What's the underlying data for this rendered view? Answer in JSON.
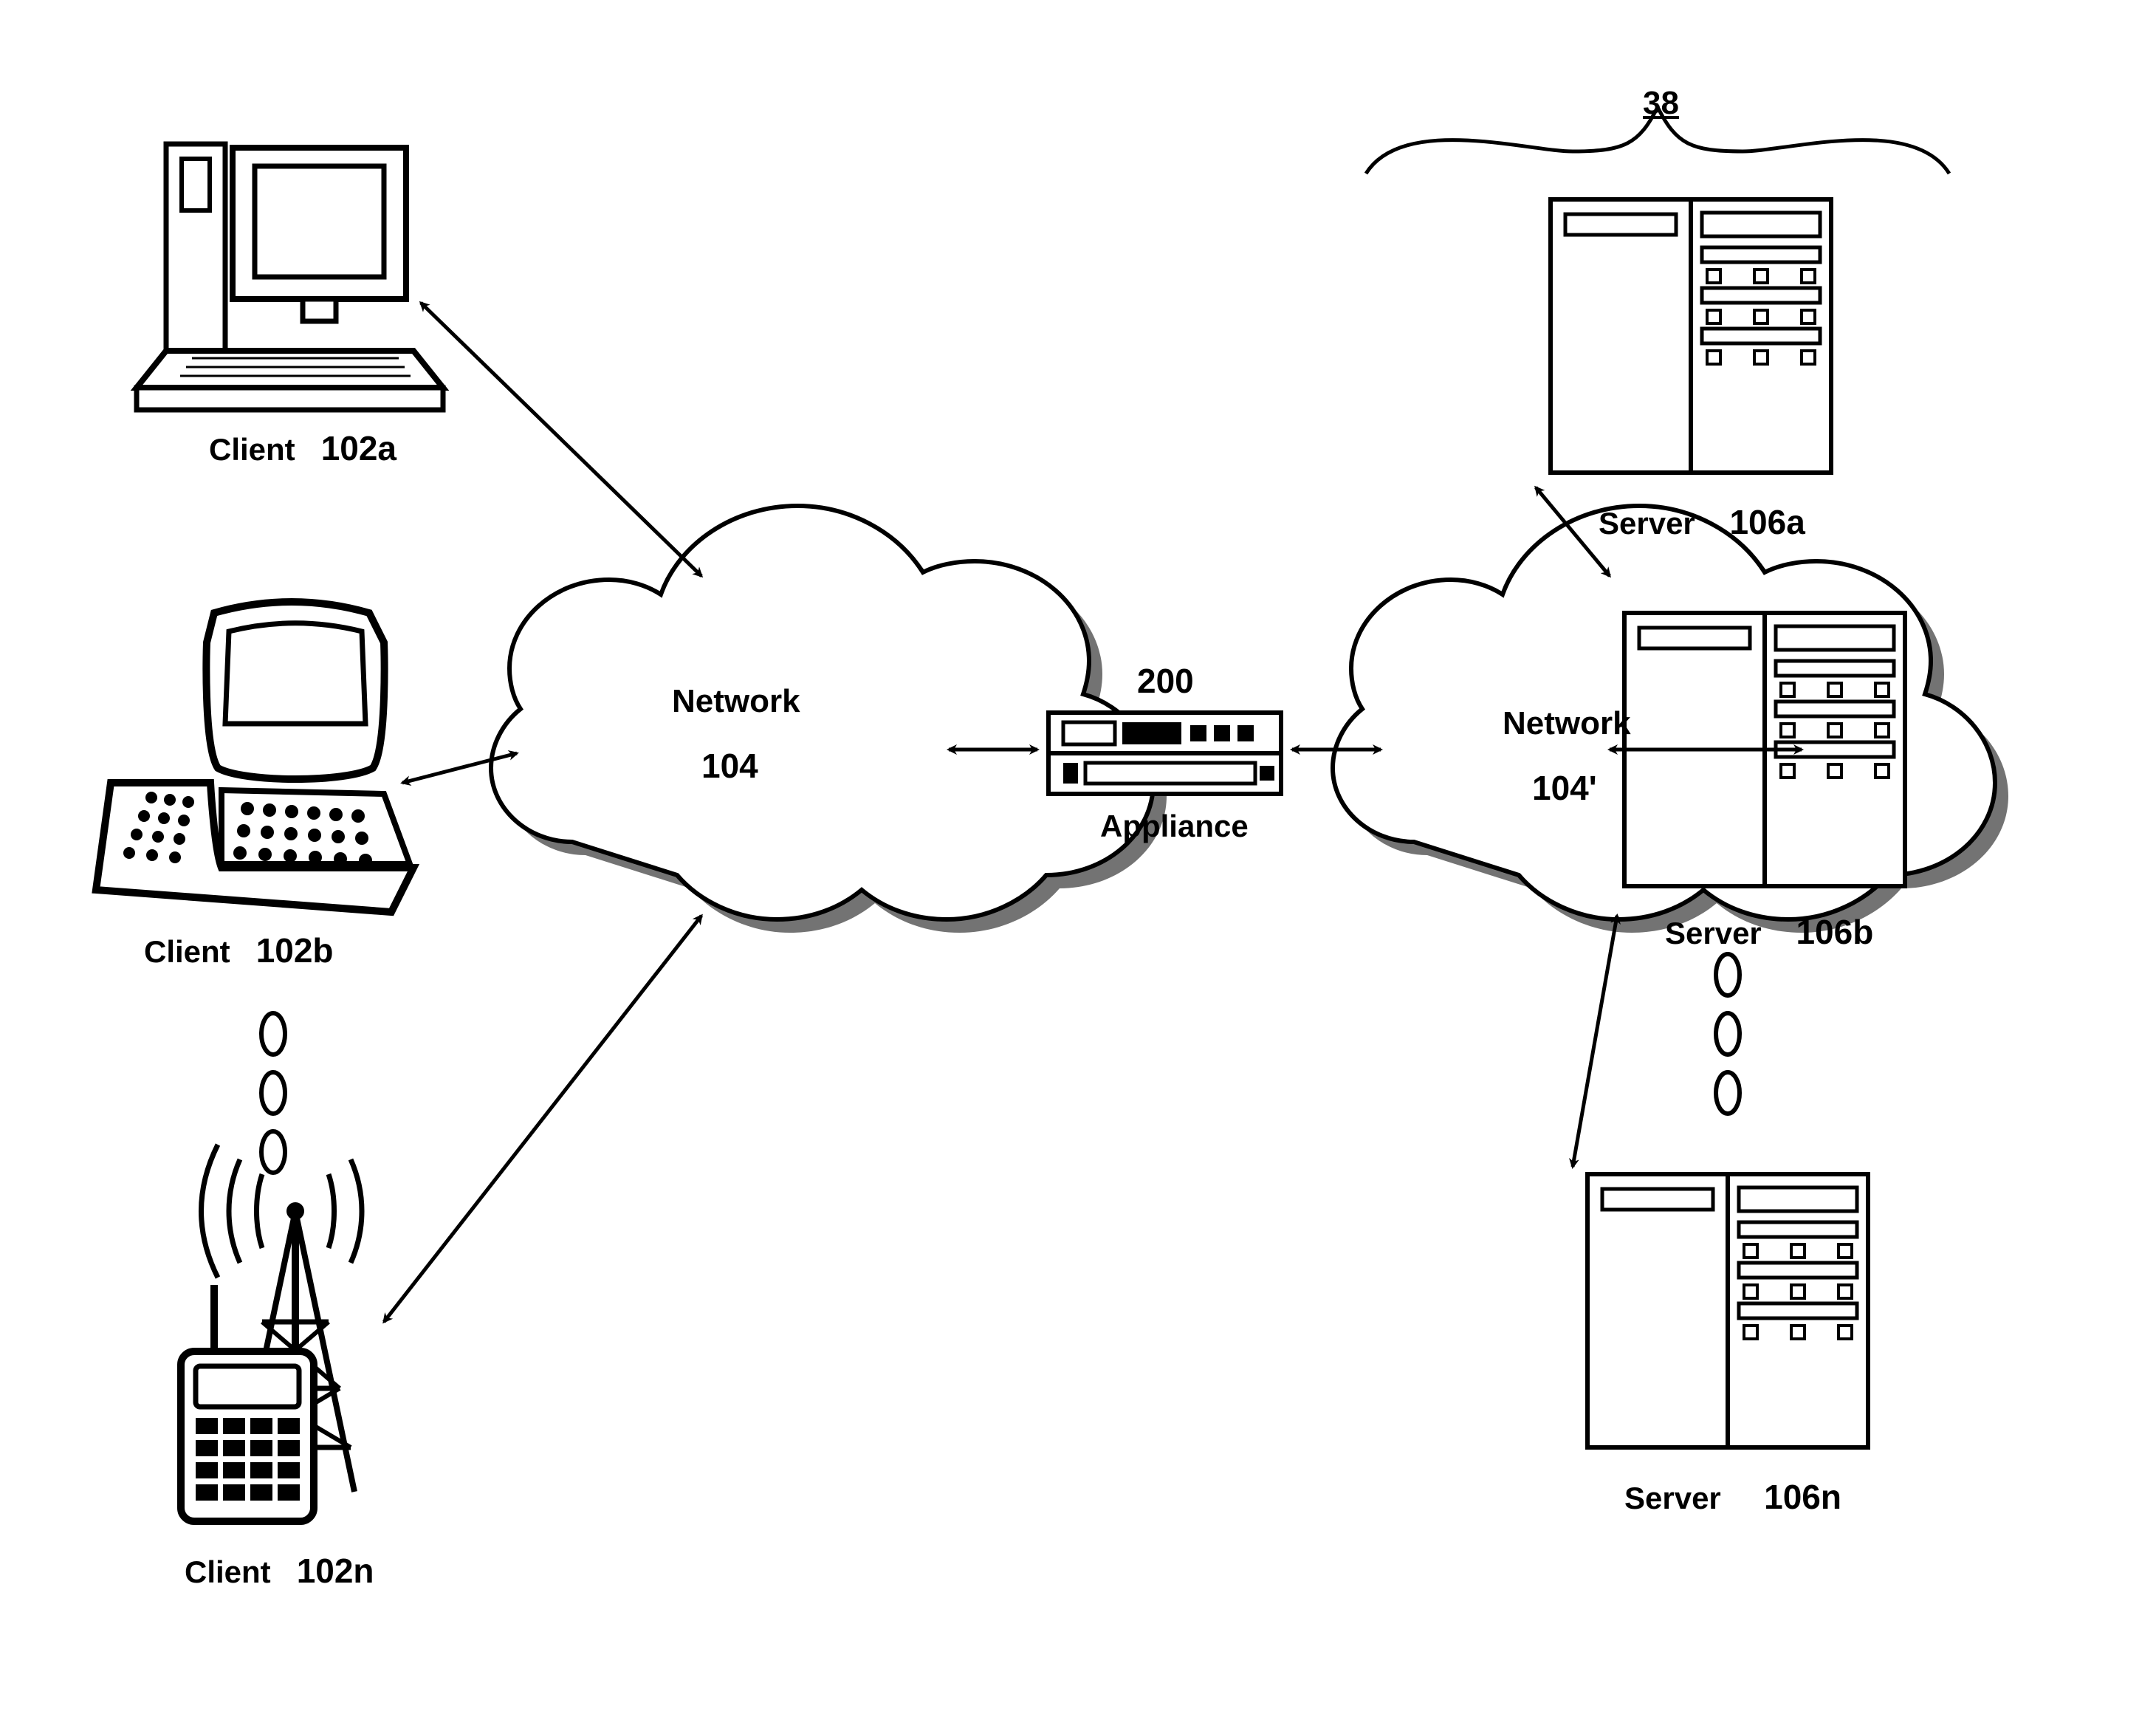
{
  "group": {
    "ref": "38"
  },
  "clients": {
    "a": {
      "label": "Client",
      "ref": "102a"
    },
    "b": {
      "label": "Client",
      "ref": "102b"
    },
    "n": {
      "label": "Client",
      "ref": "102n"
    }
  },
  "servers": {
    "a": {
      "label": "Server",
      "ref": "106a"
    },
    "b": {
      "label": "Server",
      "ref": "106b"
    },
    "n": {
      "label": "Server",
      "ref": "106n"
    }
  },
  "networks": {
    "left": {
      "label": "Network",
      "ref": "104"
    },
    "right": {
      "label": "Network",
      "ref": "104'"
    }
  },
  "appliance": {
    "label": "Appliance",
    "ref": "200"
  }
}
